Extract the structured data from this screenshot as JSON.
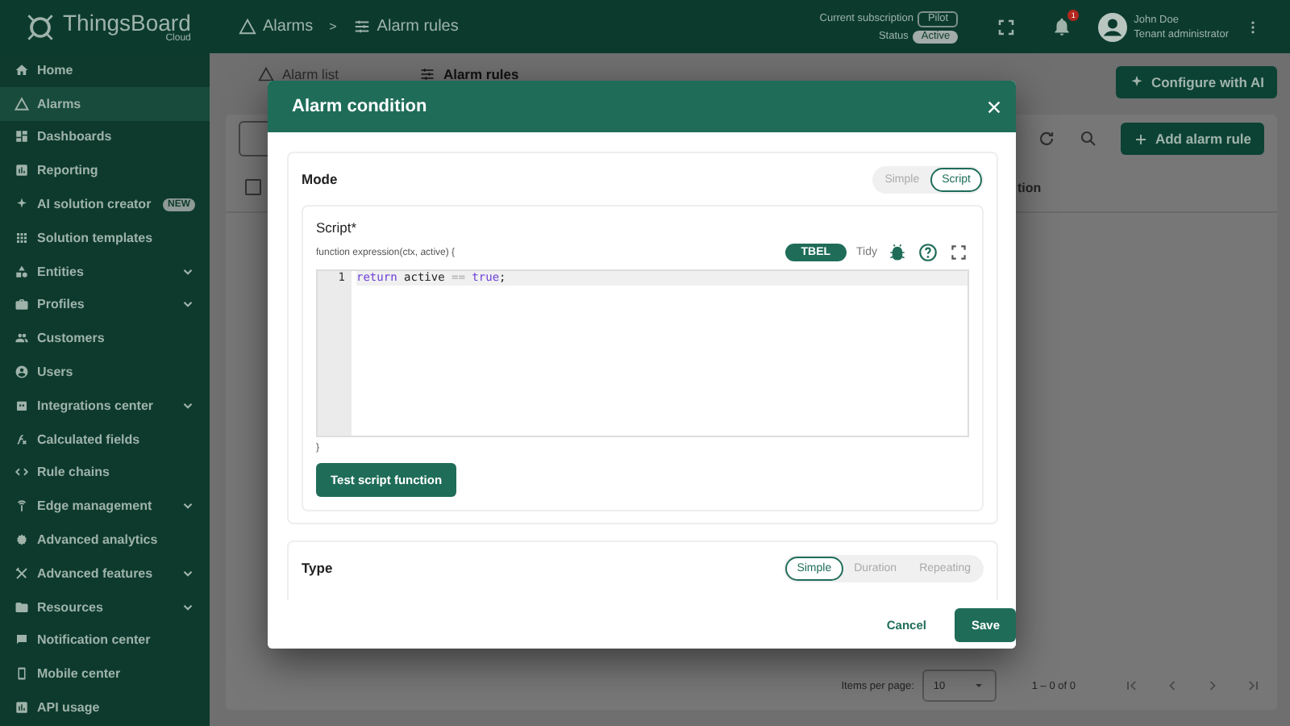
{
  "header": {
    "logo": {
      "name": "ThingsBoard",
      "subtitle": "Cloud"
    },
    "breadcrumbs": [
      {
        "label": "Alarms"
      },
      {
        "label": "Alarm rules"
      }
    ],
    "breadcrumb_separator": ">",
    "subscription": {
      "label": "Current subscription",
      "value": "Pilot"
    },
    "status": {
      "label": "Status",
      "value": "Active"
    },
    "notifications": {
      "count": "1"
    },
    "user": {
      "name": "John Doe",
      "role": "Tenant administrator"
    }
  },
  "sidebar": {
    "items": [
      {
        "label": "Home",
        "selected": false,
        "expandable": false
      },
      {
        "label": "Alarms",
        "selected": true,
        "expandable": false
      },
      {
        "label": "Dashboards",
        "selected": false,
        "expandable": false
      },
      {
        "label": "Reporting",
        "selected": false,
        "expandable": false
      },
      {
        "label": "AI solution creator",
        "selected": false,
        "expandable": false,
        "badge": "NEW"
      },
      {
        "label": "Solution templates",
        "selected": false,
        "expandable": false
      },
      {
        "label": "Entities",
        "selected": false,
        "expandable": true
      },
      {
        "label": "Profiles",
        "selected": false,
        "expandable": true
      },
      {
        "label": "Customers",
        "selected": false,
        "expandable": false
      },
      {
        "label": "Users",
        "selected": false,
        "expandable": false
      },
      {
        "label": "Integrations center",
        "selected": false,
        "expandable": true
      },
      {
        "label": "Calculated fields",
        "selected": false,
        "expandable": false
      },
      {
        "label": "Rule chains",
        "selected": false,
        "expandable": false
      },
      {
        "label": "Edge management",
        "selected": false,
        "expandable": true
      },
      {
        "label": "Advanced analytics",
        "selected": false,
        "expandable": false
      },
      {
        "label": "Advanced features",
        "selected": false,
        "expandable": true
      },
      {
        "label": "Resources",
        "selected": false,
        "expandable": true
      },
      {
        "label": "Notification center",
        "selected": false,
        "expandable": false
      },
      {
        "label": "Mobile center",
        "selected": false,
        "expandable": false
      },
      {
        "label": "API usage",
        "selected": false,
        "expandable": false
      }
    ]
  },
  "page": {
    "tabs": [
      {
        "label": "Alarm list",
        "selected": false
      },
      {
        "label": "Alarm rules",
        "selected": true
      }
    ],
    "configure_button": "Configure with AI",
    "add_button": "Add alarm rule",
    "table": {
      "select_all_checked": false,
      "columns": [
        "tion"
      ]
    },
    "paginator": {
      "items_per_page_label": "Items per page:",
      "page_size": "10",
      "range": "1 – 0 of 0"
    }
  },
  "dialog": {
    "title": "Alarm condition",
    "mode": {
      "label": "Mode",
      "options": [
        {
          "label": "Simple",
          "selected": false
        },
        {
          "label": "Script",
          "selected": true
        }
      ],
      "script": {
        "label": "Script*",
        "signature": "function expression(ctx, active) {",
        "language": "TBEL",
        "tidy": "Tidy",
        "lines": [
          {
            "number": "1",
            "tokens": [
              {
                "text": "return",
                "kind": "keyword"
              },
              {
                "text": " active ",
                "kind": "plain"
              },
              {
                "text": "== ",
                "kind": "operator"
              },
              {
                "text": "true",
                "kind": "keyword"
              },
              {
                "text": ";",
                "kind": "plain"
              }
            ]
          }
        ],
        "closing": "}",
        "test_button": "Test script function"
      }
    },
    "type": {
      "label": "Type",
      "options": [
        {
          "label": "Simple",
          "selected": true
        },
        {
          "label": "Duration",
          "selected": false
        },
        {
          "label": "Repeating",
          "selected": false
        }
      ]
    },
    "buttons": {
      "cancel": "Cancel",
      "save": "Save"
    }
  }
}
